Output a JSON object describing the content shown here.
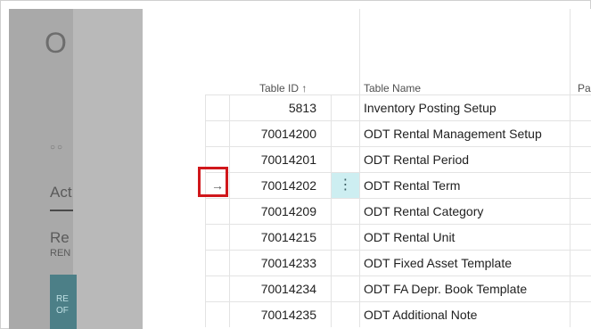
{
  "background": {
    "title": "O",
    "dots": "○○",
    "tab": "Act",
    "heading": "Re",
    "subheading": "REN",
    "tile": [
      "RE",
      "OF"
    ]
  },
  "table": {
    "columns": [
      {
        "key": "table_id",
        "label": "Table ID",
        "sort": "↑"
      },
      {
        "key": "table_name",
        "label": "Table Name"
      },
      {
        "key": "partial",
        "label": "Pa"
      }
    ],
    "rows": [
      {
        "id": "5813",
        "name": "Inventory Posting Setup",
        "active": false
      },
      {
        "id": "70014200",
        "name": "ODT Rental Management Setup",
        "active": false
      },
      {
        "id": "70014201",
        "name": "ODT Rental Period",
        "active": false
      },
      {
        "id": "70014202",
        "name": "ODT Rental Term",
        "active": true
      },
      {
        "id": "70014209",
        "name": "ODT Rental Category",
        "active": false
      },
      {
        "id": "70014215",
        "name": "ODT Rental Unit",
        "active": false
      },
      {
        "id": "70014233",
        "name": "ODT Fixed Asset Template",
        "active": false
      },
      {
        "id": "70014234",
        "name": "ODT FA Depr. Book Template",
        "active": false
      },
      {
        "id": "70014235",
        "name": "ODT Additional Note",
        "active": false
      }
    ],
    "row_menu_glyph": "⋮",
    "selected_row_glyph": "→"
  },
  "colors": {
    "highlight_border": "#d0171b",
    "active_cell_bg": "#cdeef1",
    "overlay_gray": "#a9a9a9"
  }
}
